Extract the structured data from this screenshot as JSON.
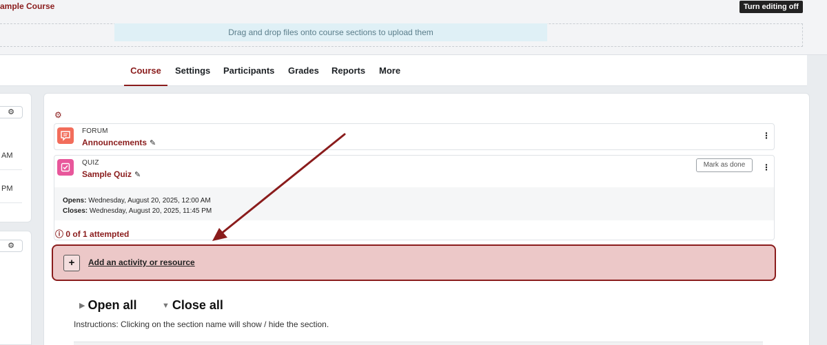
{
  "header": {
    "course_crumb": "ample Course",
    "turn_editing": "Turn editing off",
    "dropzone_message": "Drag and drop files onto course sections to upload them"
  },
  "nav": {
    "tabs": [
      {
        "label": "Course",
        "active": true
      },
      {
        "label": "Settings"
      },
      {
        "label": "Participants"
      },
      {
        "label": "Grades"
      },
      {
        "label": "Reports"
      },
      {
        "label": "More"
      }
    ]
  },
  "left_panel": {
    "am": "AM",
    "pm": "PM"
  },
  "activities": [
    {
      "type": "FORUM",
      "name": "Announcements",
      "icon": "forum-icon",
      "icon_color": "#f26d5b"
    },
    {
      "type": "QUIZ",
      "name": "Sample Quiz",
      "icon": "quiz-icon",
      "icon_color": "#e8579b",
      "mark_done": "Mark as done"
    }
  ],
  "quiz_dates": {
    "opens_label": "Opens:",
    "opens_value": " Wednesday, August 20, 2025, 12:00 AM",
    "closes_label": "Closes:",
    "closes_value": " Wednesday, August 20, 2025, 11:45 PM"
  },
  "attempted": "0 of 1 attempted",
  "add_activity": "Add an activity or resource",
  "open_all": "Open all",
  "close_all": "Close all",
  "instructions": "Instructions: Clicking on the section name will show / hide the section.",
  "colors": {
    "brand": "#8a1c1c",
    "highlight": "#ecc8c8"
  }
}
